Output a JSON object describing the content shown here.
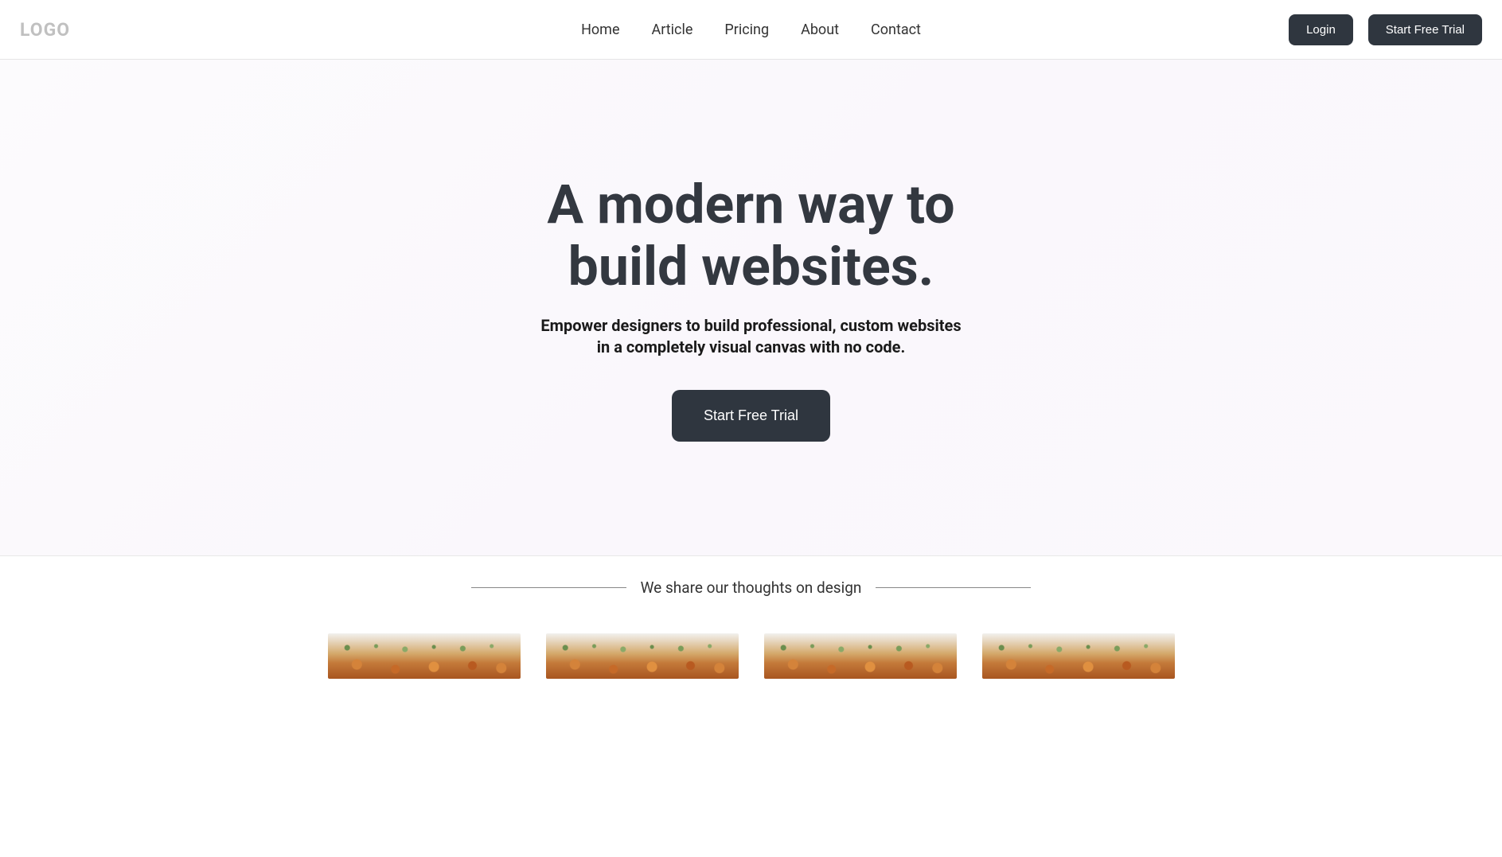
{
  "header": {
    "logo": "LOGO",
    "nav": [
      "Home",
      "Article",
      "Pricing",
      "About",
      "Contact"
    ],
    "login_label": "Login",
    "trial_label": "Start Free Trial"
  },
  "hero": {
    "title_line1": "A modern way to",
    "title_line2": "build websites.",
    "subtitle_line1": "Empower designers to build professional, custom websites",
    "subtitle_line2": "in a completely visual canvas with no code.",
    "cta_label": "Start Free Trial"
  },
  "divider": {
    "text": "We share our thoughts on design"
  }
}
